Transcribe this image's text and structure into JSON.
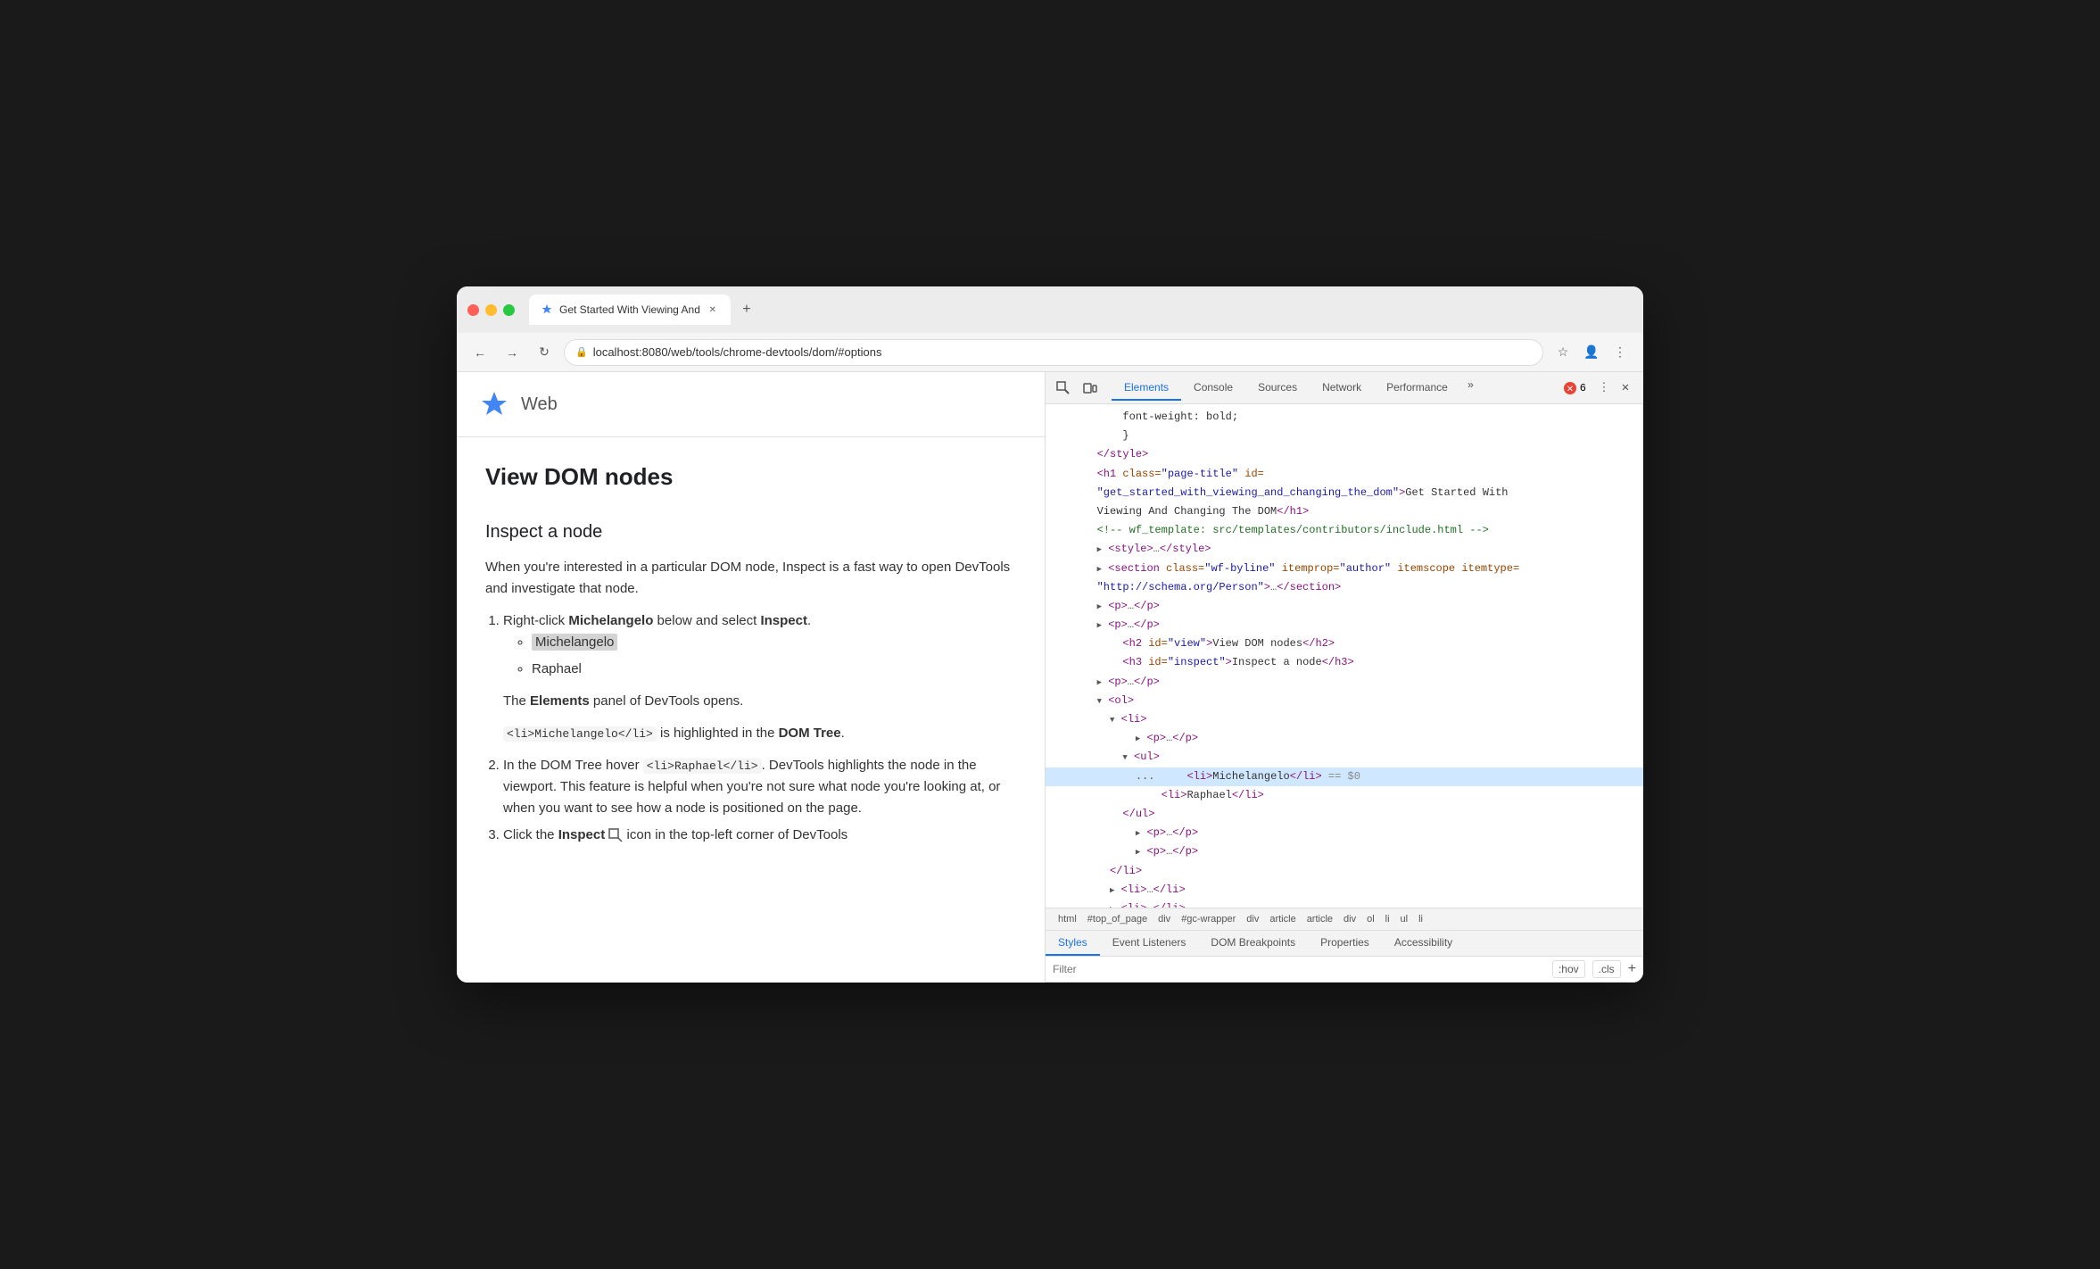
{
  "browser": {
    "tab_title": "Get Started With Viewing And",
    "url": "localhost:8080/web/tools/chrome-devtools/dom/#options",
    "favicon_symbol": "✦"
  },
  "webpage": {
    "site_name": "Web",
    "article": {
      "heading": "View DOM nodes",
      "subheading": "Inspect a node",
      "intro": "When you're interested in a particular DOM node, Inspect is a fast way to open DevTools and investigate that node.",
      "step1_prefix": "Right-click ",
      "step1_name": "Michelangelo",
      "step1_suffix": " below and select ",
      "step1_action": "Inspect",
      "step1_end": ".",
      "bullet1": "Michelangelo",
      "bullet2": "Raphael",
      "step1_note": "The ",
      "step1_note_bold": "Elements",
      "step1_note_suffix": " panel of DevTools opens.",
      "code1": "<li>Michelangelo</li>",
      "code1_note": " is highlighted in the ",
      "code1_note_bold": "DOM Tree",
      "code1_note_end": ".",
      "step2_prefix": "In the DOM Tree hover ",
      "step2_code": "<li>Raphael</li>",
      "step2_suffix": ". DevTools highlights the node in the viewport. This feature is helpful when you're not sure what node you're looking at, or when you want to see how a node is positioned on the page.",
      "step3_prefix": "Click the ",
      "step3_bold": "Inspect",
      "step3_suffix": " icon in the top-left corner of DevTools"
    }
  },
  "devtools": {
    "tabs": [
      "Elements",
      "Console",
      "Sources",
      "Network",
      "Performance"
    ],
    "more_label": "»",
    "error_count": "6",
    "dom_lines": [
      {
        "indent": "            ",
        "content": "font-weight: bold;",
        "type": "text"
      },
      {
        "indent": "            ",
        "content": "}",
        "type": "text"
      },
      {
        "indent": "        ",
        "content": "</style>",
        "type": "tag"
      },
      {
        "indent": "        ",
        "content": "<h1 class=\"page-title\" id=",
        "type": "tag"
      },
      {
        "indent": "        ",
        "content": "\"get_started_with_viewing_and_changing_the_dom\">Get Started With",
        "type": "attr_value"
      },
      {
        "indent": "        ",
        "content": "Viewing And Changing The DOM</h1>",
        "type": "text"
      },
      {
        "indent": "        ",
        "content": "<!-- wf_template: src/templates/contributors/include.html -->",
        "type": "comment"
      },
      {
        "indent": "        ",
        "content": "▶ <style>…</style>",
        "type": "tag"
      },
      {
        "indent": "        ",
        "content": "▶ <section class=\"wf-byline\" itemprop=\"author\" itemscope itemtype=",
        "type": "tag"
      },
      {
        "indent": "        ",
        "content": "\"http://schema.org/Person\">…</section>",
        "type": "attr_value"
      },
      {
        "indent": "        ",
        "content": "▶ <p>…</p>",
        "type": "tag"
      },
      {
        "indent": "        ",
        "content": "▶ <p>…</p>",
        "type": "tag"
      },
      {
        "indent": "        ",
        "content": "    <h2 id=\"view\">View DOM nodes</h2>",
        "type": "tag"
      },
      {
        "indent": "        ",
        "content": "    <h3 id=\"inspect\">Inspect a node</h3>",
        "type": "tag"
      },
      {
        "indent": "        ",
        "content": "▶ <p>…</p>",
        "type": "tag"
      },
      {
        "indent": "        ",
        "content": "▼ <ol>",
        "type": "tag"
      },
      {
        "indent": "          ",
        "content": "▼ <li>",
        "type": "tag"
      },
      {
        "indent": "            ",
        "content": "▶ <p>…</p>",
        "type": "tag"
      },
      {
        "indent": "            ",
        "content": "▼ <ul>",
        "type": "tag"
      },
      {
        "indent": "              ",
        "content": "    <li>Michelangelo</li> == $0",
        "type": "highlighted"
      },
      {
        "indent": "              ",
        "content": "    <li>Raphael</li>",
        "type": "tag"
      },
      {
        "indent": "            ",
        "content": "    </ul>",
        "type": "tag"
      },
      {
        "indent": "            ",
        "content": "▶ <p>…</p>",
        "type": "tag"
      },
      {
        "indent": "            ",
        "content": "▶ <p>…</p>",
        "type": "tag"
      },
      {
        "indent": "          ",
        "content": "  </li>",
        "type": "tag"
      },
      {
        "indent": "          ",
        "content": "▶ <li>…</li>",
        "type": "tag"
      },
      {
        "indent": "          ",
        "content": "▶ <li>…</li>",
        "type": "tag"
      }
    ],
    "breadcrumb": [
      "html",
      "#top_of_page",
      "div",
      "#gc-wrapper",
      "div",
      "article",
      "article",
      "div",
      "ol",
      "li",
      "ul",
      "li"
    ],
    "bottom_tabs": [
      "Styles",
      "Event Listeners",
      "DOM Breakpoints",
      "Properties",
      "Accessibility"
    ],
    "filter_placeholder": "Filter",
    "filter_tags": [
      ":hov",
      ".cls"
    ],
    "filter_add": "+"
  }
}
